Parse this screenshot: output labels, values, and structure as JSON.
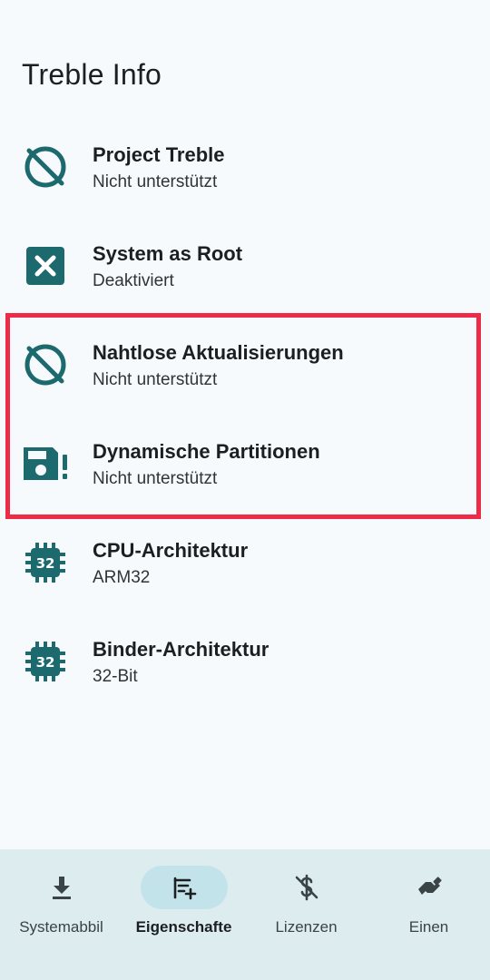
{
  "page": {
    "title": "Treble Info"
  },
  "colors": {
    "accent": "#1d6a6e",
    "highlight": "#ee2b47",
    "nav_bg": "#dcecef"
  },
  "items": [
    {
      "label": "Project Treble",
      "value": "Nicht unterstützt",
      "icon": "not-supported-icon"
    },
    {
      "label": "System as Root",
      "value": "Deaktiviert",
      "icon": "x-box-icon"
    },
    {
      "label": "Nahtlose Aktualisierungen",
      "value": "Nicht unterstützt",
      "icon": "not-supported-icon"
    },
    {
      "label": "Dynamische Partitionen",
      "value": "Nicht unterstützt",
      "icon": "storage-alert-icon"
    },
    {
      "label": "CPU-Architektur",
      "value": "ARM32",
      "icon": "chip-32-icon"
    },
    {
      "label": "Binder-Architektur",
      "value": "32-Bit",
      "icon": "chip-32-icon"
    }
  ],
  "bottom_nav": [
    {
      "label": "Systemabbil",
      "icon": "download-icon",
      "active": false
    },
    {
      "label": "Eigenschafte",
      "icon": "list-add-icon",
      "active": true
    },
    {
      "label": "Lizenzen",
      "icon": "no-money-icon",
      "active": false
    },
    {
      "label": "Einen",
      "icon": "handshake-icon",
      "active": false
    }
  ]
}
